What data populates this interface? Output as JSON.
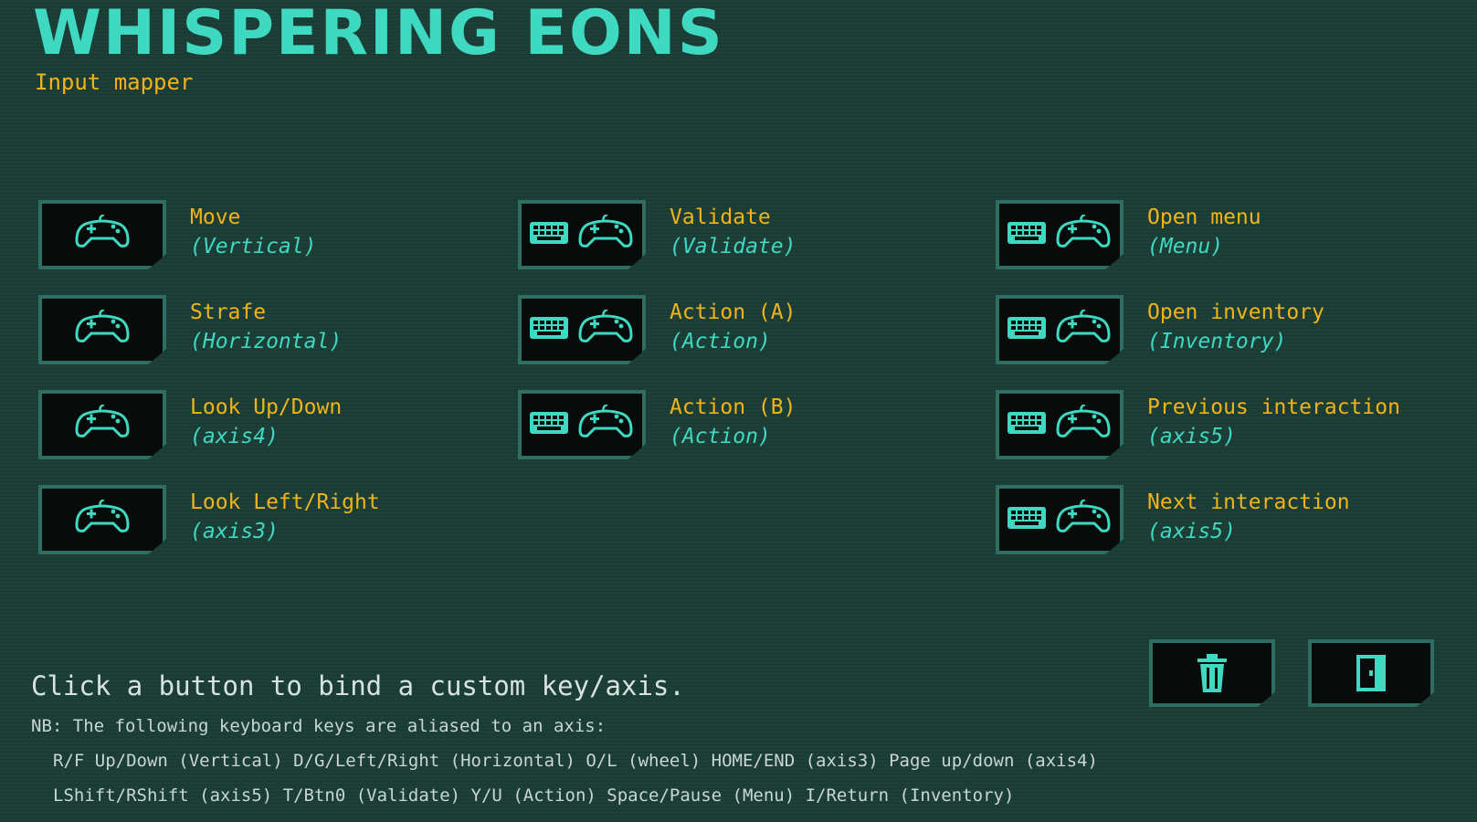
{
  "title": "WHISPERING EONS",
  "subtitle": "Input mapper",
  "colors": {
    "background": "#1c3f37",
    "accent": "#3fd8c0",
    "label": "#f0b419",
    "button_bg": "#070b0a",
    "button_border": "#2e6d62"
  },
  "bindings": [
    {
      "name": "Move",
      "axis": "(Vertical)",
      "icons": [
        "gamepad-icon"
      ]
    },
    {
      "name": "Strafe",
      "axis": "(Horizontal)",
      "icons": [
        "gamepad-icon"
      ]
    },
    {
      "name": "Look Up/Down",
      "axis": "(axis4)",
      "icons": [
        "gamepad-icon"
      ]
    },
    {
      "name": "Look Left/Right",
      "axis": "(axis3)",
      "icons": [
        "gamepad-icon"
      ]
    },
    {
      "name": "Validate",
      "axis": "(Validate)",
      "icons": [
        "keyboard-icon",
        "gamepad-icon"
      ]
    },
    {
      "name": "Action (A)",
      "axis": "(Action)",
      "icons": [
        "keyboard-icon",
        "gamepad-icon"
      ]
    },
    {
      "name": "Action (B)",
      "axis": "(Action)",
      "icons": [
        "keyboard-icon",
        "gamepad-icon"
      ]
    },
    {
      "name": "Open menu",
      "axis": "(Menu)",
      "icons": [
        "keyboard-icon",
        "gamepad-icon"
      ]
    },
    {
      "name": "Open inventory",
      "axis": "(Inventory)",
      "icons": [
        "keyboard-icon",
        "gamepad-icon"
      ]
    },
    {
      "name": "Previous interaction",
      "axis": "(axis5)",
      "icons": [
        "keyboard-icon",
        "gamepad-icon"
      ]
    },
    {
      "name": "Next interaction",
      "axis": "(axis5)",
      "icons": [
        "keyboard-icon",
        "gamepad-icon"
      ]
    }
  ],
  "tools": [
    {
      "icon": "trash-icon"
    },
    {
      "icon": "exit-door-icon"
    }
  ],
  "instruction": "Click a button to bind a custom key/axis.",
  "note": "NB: The following keyboard keys are aliased to an axis:",
  "aliases": [
    "R/F Up/Down (Vertical) D/G/Left/Right (Horizontal) O/L (wheel) HOME/END (axis3) Page up/down (axis4)",
    "LShift/RShift (axis5) T/Btn0 (Validate) Y/U (Action) Space/Pause (Menu) I/Return (Inventory)"
  ]
}
